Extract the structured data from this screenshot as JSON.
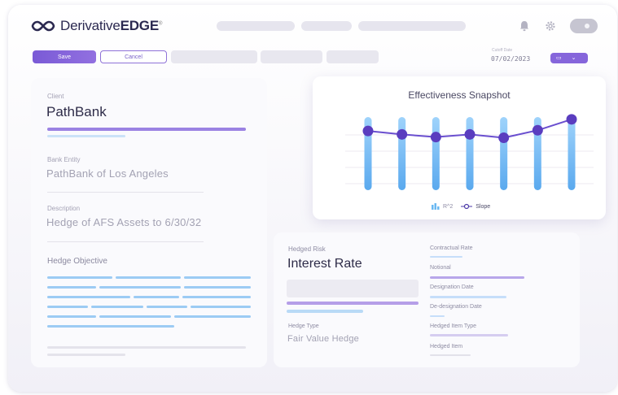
{
  "header": {
    "logo_prefix": "Derivative",
    "logo_bold": "EDGE",
    "logo_tm": "®",
    "icons": [
      "bell-icon",
      "gear-icon",
      "toggle-switch"
    ]
  },
  "toolbar": {
    "save_label": "Save",
    "cancel_label": "Cancel",
    "date_label": "Cutoff Date",
    "date_value": "07/02/2023"
  },
  "details": {
    "client_label": "Client",
    "client_value": "PathBank",
    "bank_entity_label": "Bank Entity",
    "bank_entity_value": "PathBank of Los Angeles",
    "description_label": "Description",
    "description_value": "Hedge of AFS Assets to 6/30/32",
    "objective_label": "Hedge Objective"
  },
  "chart_data": {
    "type": "line",
    "title": "Effectiveness Snapshot",
    "x": [
      1,
      2,
      3,
      4,
      5,
      6,
      7
    ],
    "series": [
      {
        "name": "R^2",
        "kind": "bar",
        "values": [
          1,
          1,
          1,
          1,
          1,
          1,
          1
        ]
      },
      {
        "name": "Slope",
        "kind": "line",
        "values": [
          0.82,
          0.77,
          0.73,
          0.77,
          0.72,
          0.83,
          0.99
        ]
      }
    ],
    "grid": true,
    "legend": "bottom-center",
    "colors": {
      "bars": "#6ab8f2",
      "line": "#5a3dbf"
    }
  },
  "hedge": {
    "risk_label": "Hedged Risk",
    "risk_value": "Interest Rate",
    "type_label": "Hedge Type",
    "type_value": "Fair Value Hedge",
    "fields": [
      "Contractual Rate",
      "Notional",
      "Designation Date",
      "De-designation Date",
      "Hedged Item Type",
      "Hedged Item"
    ]
  },
  "colors": {
    "accent": "#8666db",
    "accent_light": "#b7a8ea",
    "blue": "#8fc6f5"
  }
}
